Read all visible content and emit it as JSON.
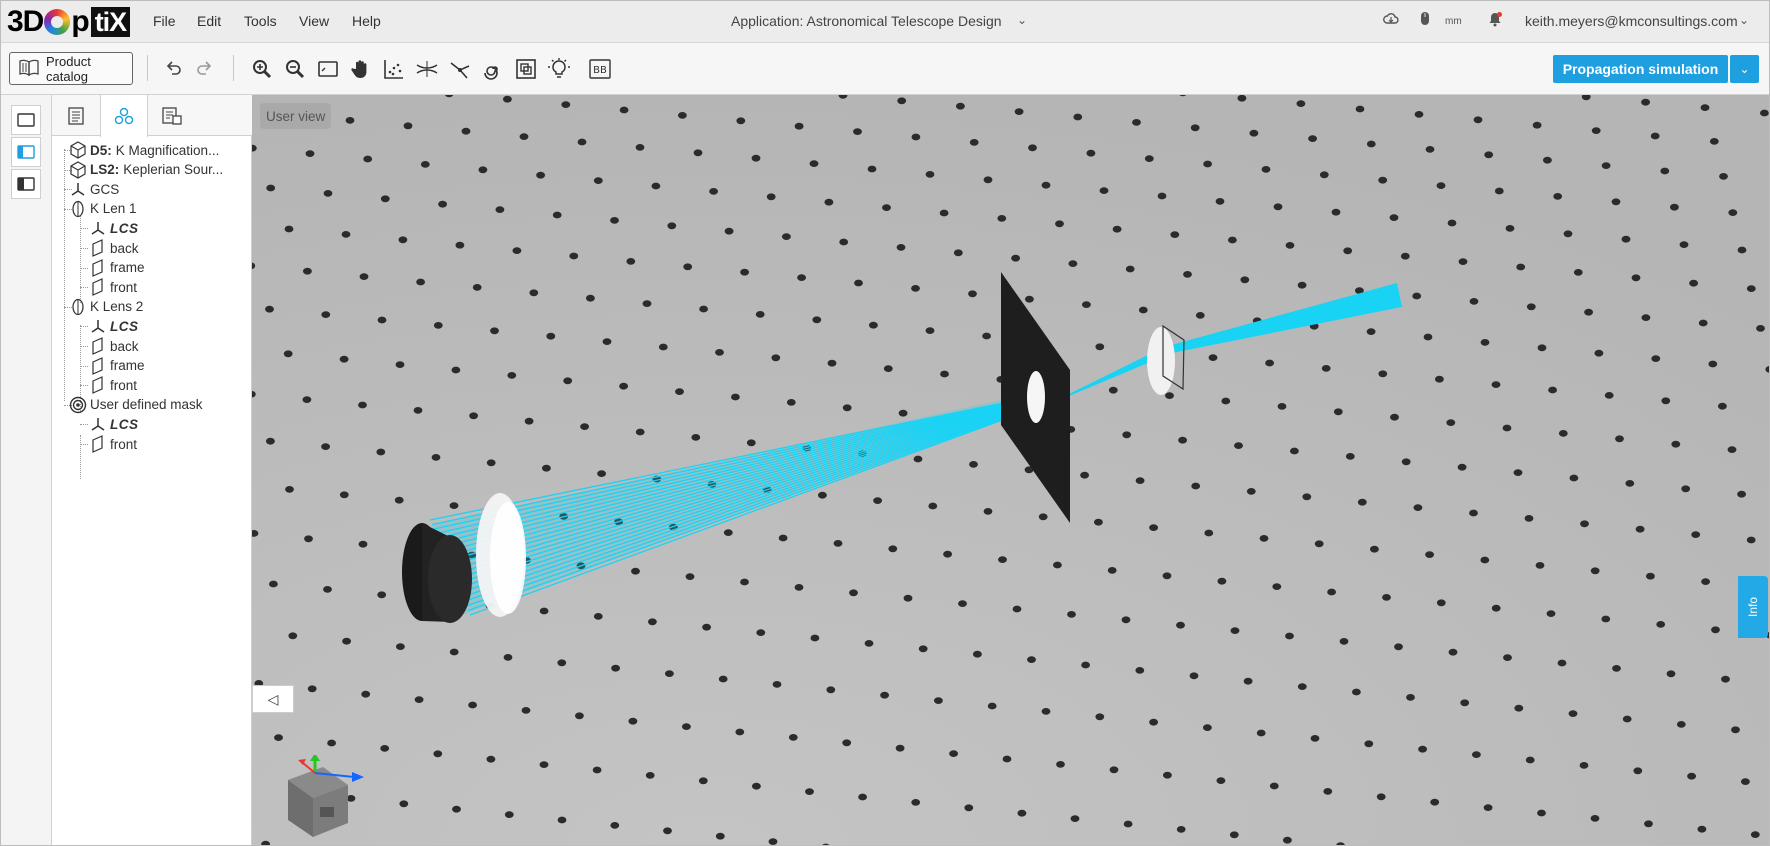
{
  "app": {
    "logo_text": "3DOptiX",
    "logo_parts": {
      "prefix": "3D",
      "mid": "p",
      "suffix": "tiX"
    }
  },
  "menu": {
    "items": [
      "File",
      "Edit",
      "Tools",
      "View",
      "Help"
    ]
  },
  "header": {
    "application_title": "Application: Astronomical Telescope Design",
    "unit": "mm",
    "user_email": "keith.meyers@kmconsultings.com"
  },
  "toolbar": {
    "product_catalog_label": "Product catalog",
    "buttons": [
      "undo",
      "redo",
      "zoom-in",
      "zoom-out",
      "fit-view",
      "pan",
      "measure",
      "ray-tools",
      "scatter",
      "spiral",
      "group",
      "light",
      "bounding-box"
    ],
    "bb_label": "BB",
    "propagation_label": "Propagation simulation"
  },
  "tree": {
    "items": [
      {
        "prefix": "D5:",
        "label": "K Magnification...",
        "icon": "cube-icon",
        "level": 0
      },
      {
        "prefix": "LS2:",
        "label": "Keplerian Sour...",
        "icon": "cube-icon",
        "level": 0
      },
      {
        "prefix": "",
        "label": "GCS",
        "icon": "axes-icon",
        "level": 0
      },
      {
        "prefix": "",
        "label": "K Len 1",
        "icon": "lens-icon",
        "level": 0
      },
      {
        "prefix": "",
        "label": "LCS",
        "icon": "axes-icon",
        "level": 1,
        "italic": true
      },
      {
        "prefix": "",
        "label": "back",
        "icon": "surface-icon",
        "level": 1
      },
      {
        "prefix": "",
        "label": "frame",
        "icon": "surface-icon",
        "level": 1
      },
      {
        "prefix": "",
        "label": "front",
        "icon": "surface-icon",
        "level": 1
      },
      {
        "prefix": "",
        "label": "K Lens 2",
        "icon": "lens-icon",
        "level": 0
      },
      {
        "prefix": "",
        "label": "LCS",
        "icon": "axes-icon",
        "level": 1,
        "italic": true
      },
      {
        "prefix": "",
        "label": "back",
        "icon": "surface-icon",
        "level": 1
      },
      {
        "prefix": "",
        "label": "frame",
        "icon": "surface-icon",
        "level": 1
      },
      {
        "prefix": "",
        "label": "front",
        "icon": "surface-icon",
        "level": 1
      },
      {
        "prefix": "",
        "label": "User defined mask",
        "icon": "mask-icon",
        "level": 0
      },
      {
        "prefix": "",
        "label": "LCS",
        "icon": "axes-icon",
        "level": 1,
        "italic": true
      },
      {
        "prefix": "",
        "label": "front",
        "icon": "surface-icon",
        "level": 1
      }
    ]
  },
  "viewport": {
    "view_label": "User view",
    "info_label": "Info"
  },
  "colors": {
    "accent": "#1e9fe0",
    "beam": "#19d3f5",
    "background": "#b9b9b9"
  }
}
